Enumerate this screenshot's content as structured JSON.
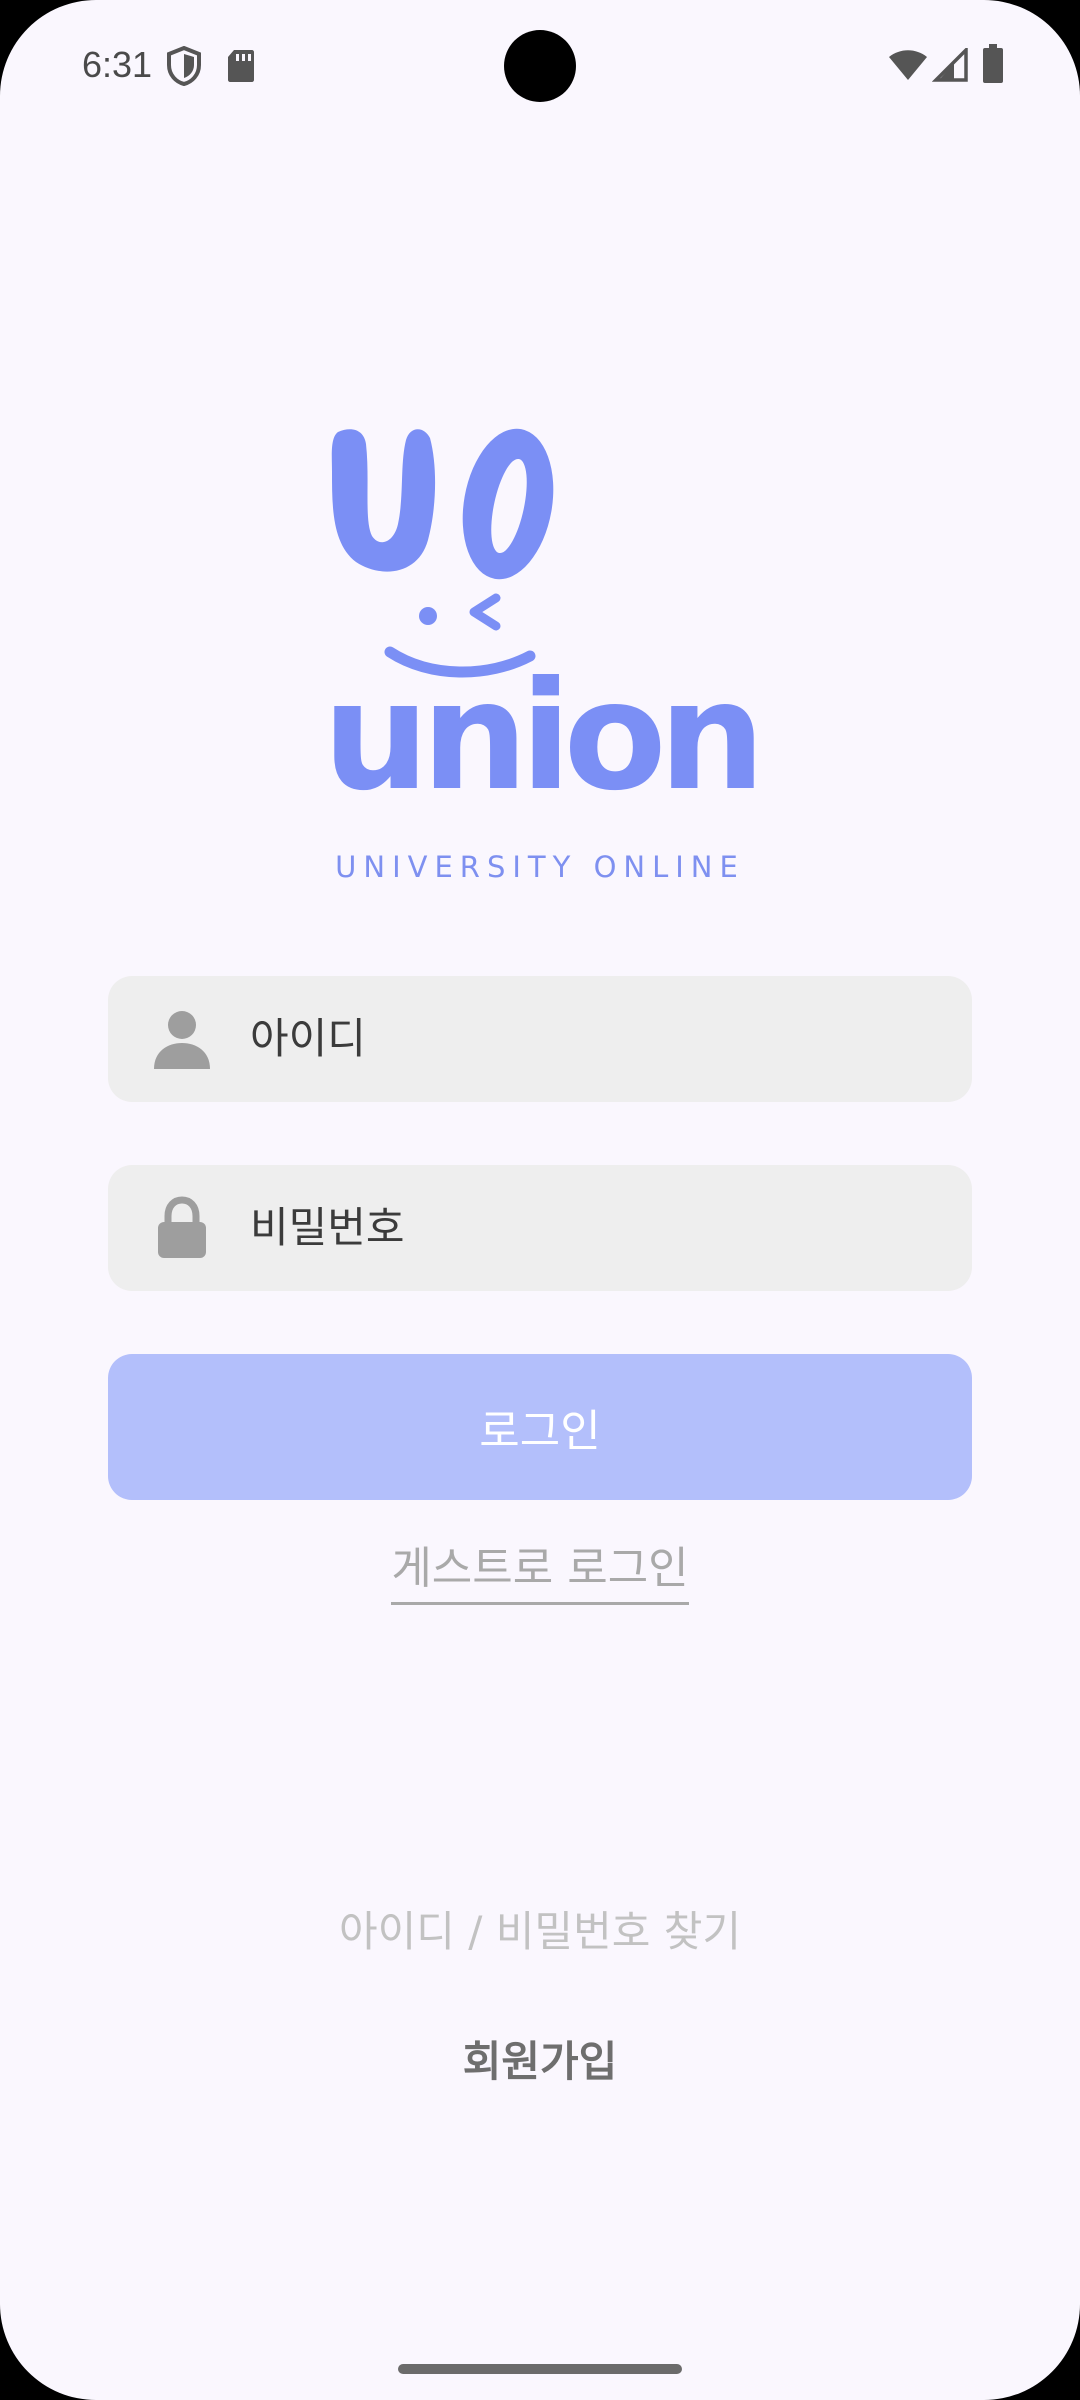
{
  "status_bar": {
    "time": "6:31",
    "icons": [
      "shield-icon",
      "sd-card-icon",
      "wifi-icon",
      "signal-icon",
      "battery-icon"
    ]
  },
  "logo": {
    "wordmark_top": "UO",
    "wordmark_bottom": "union",
    "tagline": "UNIVERSITY ONLINE",
    "color": "#7b8ff5"
  },
  "login_form": {
    "id_field": {
      "placeholder": "아이디",
      "icon": "person-icon",
      "value": ""
    },
    "password_field": {
      "placeholder": "비밀번호",
      "icon": "lock-icon",
      "value": ""
    },
    "login_button": {
      "label": "로그인",
      "color": "#b3bffb"
    },
    "guest_login": {
      "label": "게스트로 로그인"
    }
  },
  "footer": {
    "find_account": "아이디 / 비밀번호 찾기",
    "signup": "회원가입"
  }
}
